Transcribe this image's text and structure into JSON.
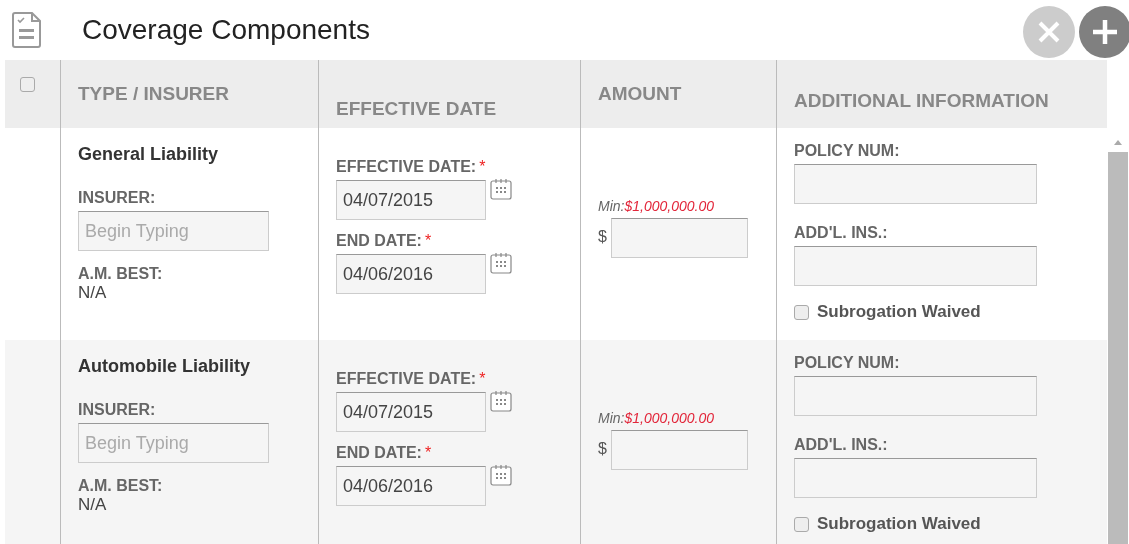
{
  "title": "Coverage Components",
  "header_checkbox": {
    "checked": false
  },
  "columns": [
    "TYPE / INSURER",
    "EFFECTIVE DATE",
    "AMOUNT",
    "ADDITIONAL INFORMATION"
  ],
  "rows": [
    {
      "type": "General Liability",
      "insurer_label": "INSURER:",
      "insurer_placeholder": "Begin Typing",
      "am_best_label": "A.M. BEST:",
      "am_best": "N/A",
      "effective_label": "EFFECTIVE DATE:",
      "required_mark": "*",
      "effective_date": "04/07/2015",
      "end_label": "END DATE:",
      "end_required_mark": "*",
      "end_date": "04/06/2016",
      "min_label": "Min:",
      "min_amount": "$1,000,000.00",
      "currency": "$",
      "policy_label": "POLICY NUM:",
      "addl_label": "ADD'L. INS.:",
      "subrogation_label": "Subrogation Waived",
      "subrogation_waived": false
    },
    {
      "type": "Automobile Liability",
      "insurer_label": "INSURER:",
      "insurer_placeholder": "Begin Typing",
      "am_best_label": "A.M. BEST:",
      "am_best": "N/A",
      "effective_label": "EFFECTIVE DATE:",
      "required_mark": "*",
      "effective_date": "04/07/2015",
      "end_label": "END DATE:",
      "end_required_mark": "*",
      "end_date": "04/06/2016",
      "min_label": "Min:",
      "min_amount": "$1,000,000.00",
      "currency": "$",
      "policy_label": "POLICY NUM:",
      "addl_label": "ADD'L. INS.:",
      "subrogation_label": "Subrogation Waived",
      "subrogation_waived": false
    }
  ]
}
